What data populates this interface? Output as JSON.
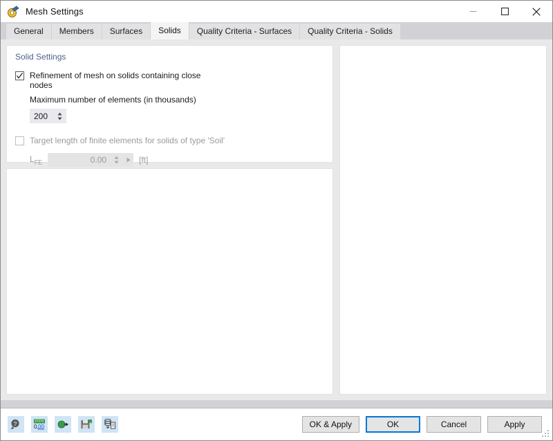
{
  "window": {
    "title": "Mesh Settings",
    "icon": "mesh-settings-icon",
    "minimize_label": "Minimize",
    "maximize_label": "Maximize",
    "close_label": "Close"
  },
  "tabs": [
    {
      "label": "General",
      "active": false
    },
    {
      "label": "Members",
      "active": false
    },
    {
      "label": "Surfaces",
      "active": false
    },
    {
      "label": "Solids",
      "active": true
    },
    {
      "label": "Quality Criteria - Surfaces",
      "active": false
    },
    {
      "label": "Quality Criteria - Solids",
      "active": false
    }
  ],
  "solids_tab": {
    "section_title": "Solid Settings",
    "refinement": {
      "label": "Refinement of mesh on solids containing close nodes",
      "checked": true,
      "enabled": true
    },
    "max_elements": {
      "label": "Maximum number of elements (in thousands)",
      "value": "200"
    },
    "target_length": {
      "label": "Target length of finite elements for solids of type 'Soil'",
      "checked": false,
      "enabled": false
    },
    "lfe": {
      "symbol": "L",
      "subscript": "FE",
      "value": "0.00",
      "unit": "[ft]"
    }
  },
  "footer": {
    "tools": [
      {
        "name": "help-magnifier-icon",
        "title": "Help"
      },
      {
        "name": "units-icon",
        "title": "Units and Decimal Places"
      },
      {
        "name": "import-plug-icon",
        "title": "Load Settings"
      },
      {
        "name": "save-settings-icon",
        "title": "Save Settings"
      },
      {
        "name": "database-export-icon",
        "title": "Export Settings"
      }
    ],
    "buttons": [
      {
        "label": "OK & Apply",
        "default": false
      },
      {
        "label": "OK",
        "default": true
      },
      {
        "label": "Cancel",
        "default": false
      },
      {
        "label": "Apply",
        "default": false
      }
    ]
  },
  "colors": {
    "accent": "#0078d7",
    "section_heading": "#4f6190",
    "dialog_bg": "#d2d2d6",
    "content_bg": "#e9e9e9",
    "tool_btn_bg": "#cfe4f5"
  }
}
